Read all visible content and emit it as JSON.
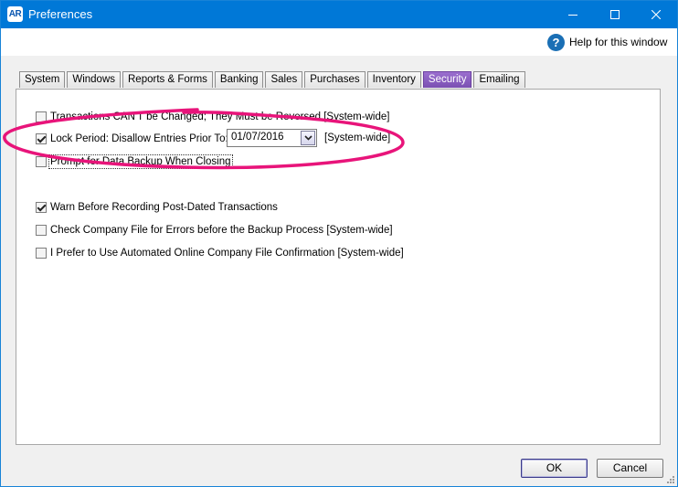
{
  "window": {
    "app_icon": "AR",
    "title": "Preferences"
  },
  "help": {
    "icon": "?",
    "label": "Help for this window"
  },
  "tabs": [
    {
      "label": "System",
      "active": false
    },
    {
      "label": "Windows",
      "active": false
    },
    {
      "label": "Reports & Forms",
      "active": false
    },
    {
      "label": "Banking",
      "active": false
    },
    {
      "label": "Sales",
      "active": false
    },
    {
      "label": "Purchases",
      "active": false
    },
    {
      "label": "Inventory",
      "active": false
    },
    {
      "label": "Security",
      "active": true
    },
    {
      "label": "Emailing",
      "active": false
    }
  ],
  "options": {
    "transactions_cant_change": {
      "label": "Transactions CAN'T be Changed; They Must be Reversed [System-wide]",
      "checked": false
    },
    "lock_period": {
      "label": "Lock Period: Disallow Entries Prior To:",
      "checked": true,
      "date": "01/07/2016",
      "suffix": "[System-wide]"
    },
    "prompt_backup": {
      "label": "Prompt for Data Backup When Closing",
      "checked": false
    },
    "warn_postdated": {
      "label": "Warn Before Recording Post-Dated Transactions",
      "checked": true
    },
    "check_company_file": {
      "label": "Check Company File for Errors before the Backup Process [System-wide]",
      "checked": false
    },
    "online_confirmation": {
      "label": "I Prefer to Use Automated Online Company File Confirmation [System-wide]",
      "checked": false
    }
  },
  "buttons": {
    "ok": "OK",
    "cancel": "Cancel"
  },
  "colors": {
    "titlebar": "#0078d7",
    "active_tab": "#8a5cc2",
    "annotation": "#e8147a"
  }
}
